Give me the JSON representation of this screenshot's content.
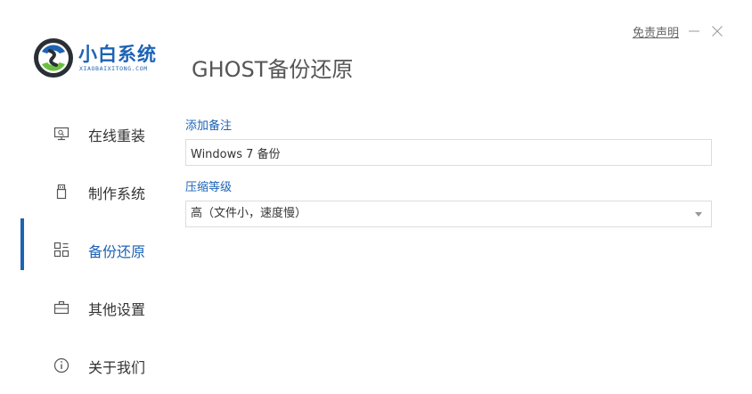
{
  "app": {
    "name": "小白系统",
    "domain": "XIAOBAIXITONG.COM",
    "page_title": "GHOST备份还原",
    "brand_color": "#1d63b5"
  },
  "window": {
    "disclaimer": "免责声明",
    "minimize_icon": "minimize-icon",
    "close_icon": "close-icon"
  },
  "sidebar": {
    "items": [
      {
        "label": "在线重装",
        "icon": "monitor-icon",
        "active": false
      },
      {
        "label": "制作系统",
        "icon": "usb-icon",
        "active": false
      },
      {
        "label": "备份还原",
        "icon": "backup-icon",
        "active": true
      },
      {
        "label": "其他设置",
        "icon": "briefcase-icon",
        "active": false
      },
      {
        "label": "关于我们",
        "icon": "info-icon",
        "active": false
      }
    ]
  },
  "form": {
    "note_label": "添加备注",
    "note_value": "Windows 7 备份",
    "compression_label": "压缩等级",
    "compression_value": "高（文件小，速度慢）"
  }
}
